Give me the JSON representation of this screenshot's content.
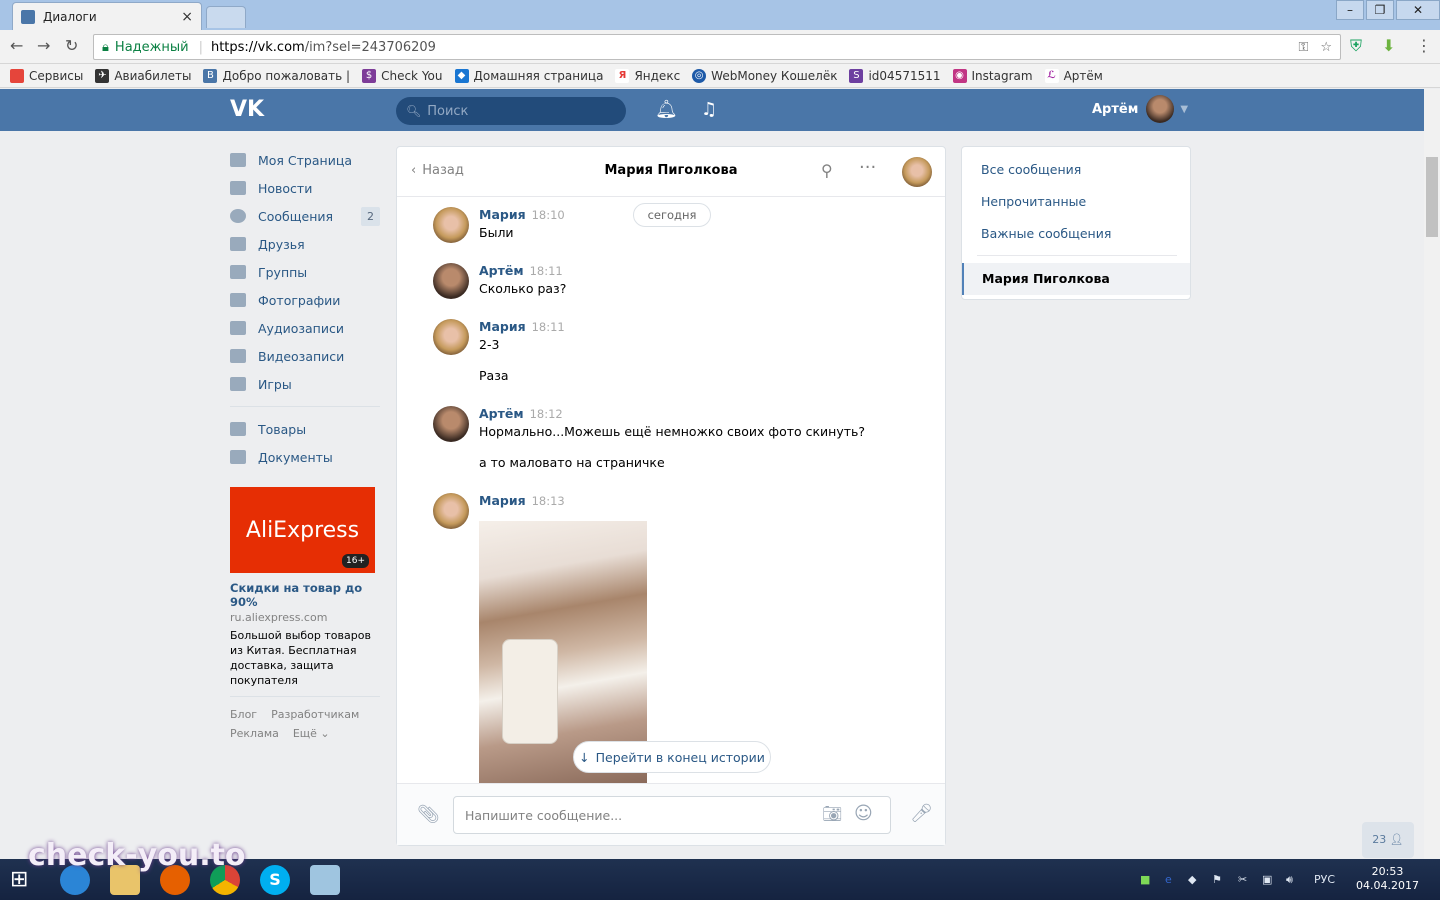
{
  "browser": {
    "tab_title": "Диалоги",
    "secure_label": "Надежный",
    "url_host": "https://vk.com",
    "url_path": "/im?sel=243706209",
    "window_buttons": [
      "–",
      "❐",
      "✕"
    ]
  },
  "bookmarks": [
    {
      "label": "Сервисы",
      "color": "#e5453b"
    },
    {
      "label": "Авиабилеты",
      "color": "#333333"
    },
    {
      "label": "Добро пожаловать |",
      "color": "#4a76a8"
    },
    {
      "label": "Check You",
      "color": "#7d3c98"
    },
    {
      "label": "Домашняя страница",
      "color": "#1976d2"
    },
    {
      "label": "Яндекс",
      "color": "#e53935"
    },
    {
      "label": "WebMoney Кошелёк",
      "color": "#1e5aa8"
    },
    {
      "label": "id04571511",
      "color": "#6d3fa0"
    },
    {
      "label": "Instagram",
      "color": "#c13584"
    },
    {
      "label": "Артём",
      "color": "#a020a0"
    }
  ],
  "vk": {
    "logo": "VK",
    "search_placeholder": "Поиск",
    "user_name": "Артём"
  },
  "leftmenu": {
    "items": [
      {
        "label": "Моя Страница"
      },
      {
        "label": "Новости"
      },
      {
        "label": "Сообщения",
        "count": "2"
      },
      {
        "label": "Друзья"
      },
      {
        "label": "Группы"
      },
      {
        "label": "Фотографии"
      },
      {
        "label": "Аудиозаписи"
      },
      {
        "label": "Видеозаписи"
      },
      {
        "label": "Игры"
      }
    ],
    "items2": [
      {
        "label": "Товары"
      },
      {
        "label": "Документы"
      }
    ],
    "ad": {
      "brand": "AliExpress",
      "age": "16+",
      "title": "Скидки на товар до 90%",
      "url": "ru.aliexpress.com",
      "text": "Большой выбор товаров из Китая. Бесплатная доставка, защита покупателя"
    },
    "footer": {
      "blog": "Блог",
      "dev": "Разработчикам",
      "ads": "Реклама",
      "more": "Ещё ⌄"
    }
  },
  "dialog": {
    "back": "Назад",
    "name": "Мария Пиголкова",
    "date_pill": "сегодня",
    "messages": [
      {
        "author": "Мария",
        "time": "18:10",
        "lines": [
          "Были"
        ]
      },
      {
        "author": "Артём",
        "time": "18:11",
        "lines": [
          "Сколько раз?"
        ]
      },
      {
        "author": "Мария",
        "time": "18:11",
        "lines": [
          "2-3",
          "Раза"
        ]
      },
      {
        "author": "Артём",
        "time": "18:12",
        "lines": [
          "Нормально...Можешь ещё немножко своих фото скинуть?",
          "а то маловато на страничке"
        ]
      },
      {
        "author": "Мария",
        "time": "18:13",
        "lines": []
      }
    ],
    "goto_end": "Перейти в конец истории",
    "input_placeholder": "Напишите сообщение..."
  },
  "rightmenu": {
    "items": [
      "Все сообщения",
      "Непрочитанные",
      "Важные сообщения"
    ],
    "selected": "Мария Пиголкова"
  },
  "friends_count": "23",
  "taskbar": {
    "lang": "РУС",
    "time": "20:53",
    "date": "04.04.2017"
  },
  "watermark": "check-you.to"
}
